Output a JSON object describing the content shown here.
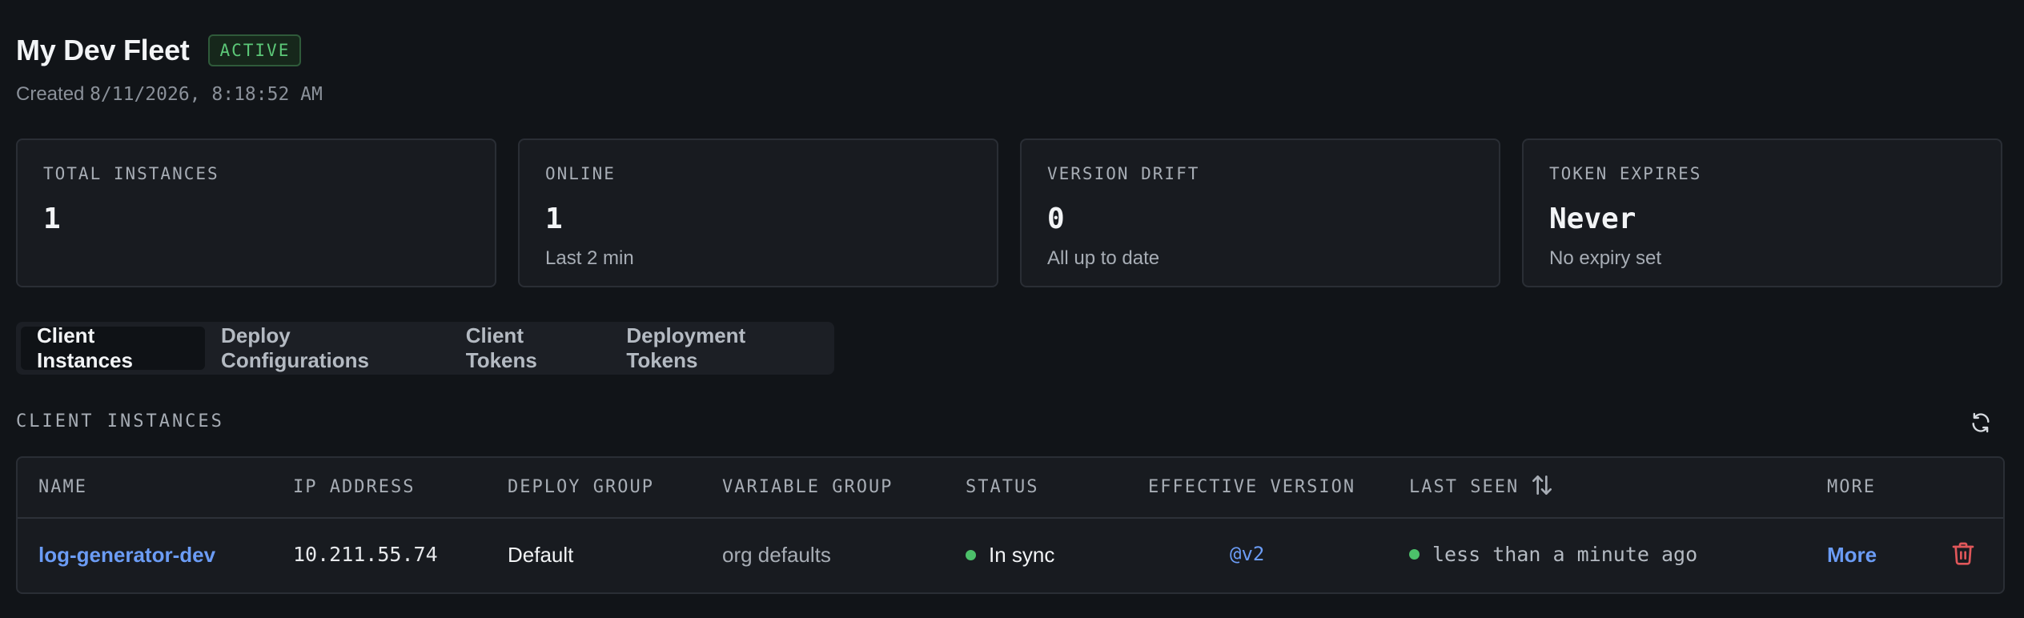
{
  "header": {
    "title": "My Dev Fleet",
    "status_badge": "ACTIVE",
    "created_prefix": "Created",
    "created_timestamp": "8/11/2026, 8:18:52 AM"
  },
  "stats": [
    {
      "label": "TOTAL INSTANCES",
      "value": "1",
      "sub": ""
    },
    {
      "label": "ONLINE",
      "value": "1",
      "sub": "Last 2 min"
    },
    {
      "label": "VERSION DRIFT",
      "value": "0",
      "sub": "All up to date"
    },
    {
      "label": "TOKEN EXPIRES",
      "value": "Never",
      "sub": "No expiry set"
    }
  ],
  "tabs": [
    {
      "label": "Client Instances",
      "active": true
    },
    {
      "label": "Deploy Configurations",
      "active": false
    },
    {
      "label": "Client Tokens",
      "active": false
    },
    {
      "label": "Deployment Tokens",
      "active": false
    }
  ],
  "section": {
    "title": "CLIENT INSTANCES",
    "refresh_icon": "refresh-icon"
  },
  "table": {
    "columns": [
      "NAME",
      "IP ADDRESS",
      "DEPLOY GROUP",
      "VARIABLE GROUP",
      "STATUS",
      "EFFECTIVE VERSION",
      "LAST SEEN",
      "MORE"
    ],
    "rows": [
      {
        "name": "log-generator-dev",
        "ip": "10.211.55.74",
        "deploy_group": "Default",
        "variable_group": "org defaults",
        "status": "In sync",
        "effective_version": "@v2",
        "last_seen": "less than a minute ago",
        "more": "More"
      }
    ]
  },
  "colors": {
    "background": "#111418",
    "accent_link": "#6b9cf5",
    "success": "#4cc06a",
    "danger": "#e0575a"
  }
}
